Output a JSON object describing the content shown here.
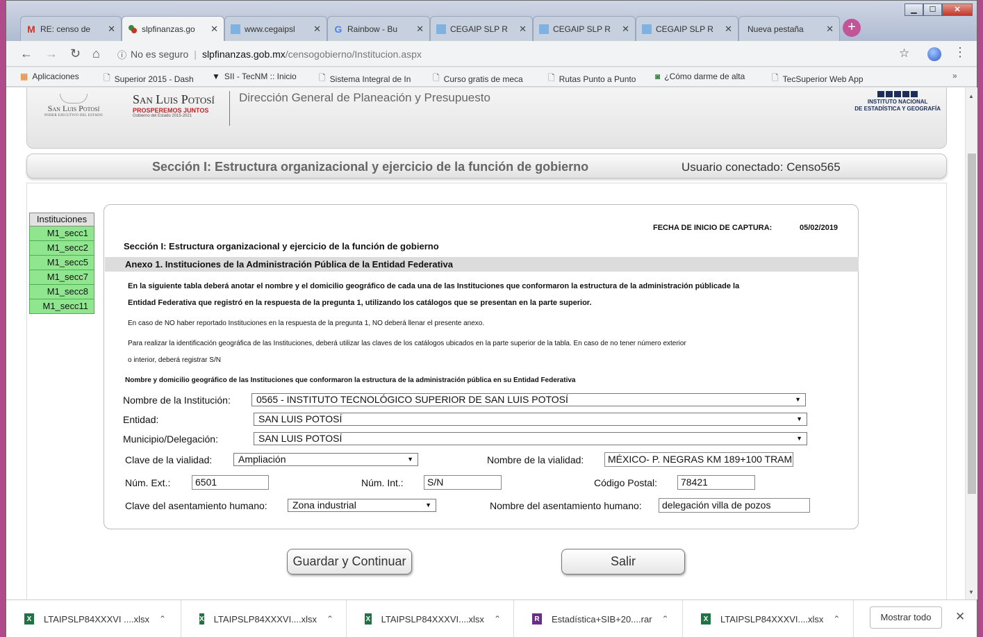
{
  "browser": {
    "tabs": [
      {
        "title": "RE: censo de",
        "favicon": "gmail-icon"
      },
      {
        "title": "slpfinanzas.go",
        "favicon": "slp-icon"
      },
      {
        "title": "www.cegaipsl",
        "favicon": "page-icon"
      },
      {
        "title": "Rainbow - Bu",
        "favicon": "google-icon"
      },
      {
        "title": "CEGAIP SLP R",
        "favicon": "page-icon"
      },
      {
        "title": "CEGAIP SLP R",
        "favicon": "page-icon"
      },
      {
        "title": "CEGAIP SLP R",
        "favicon": "page-icon"
      },
      {
        "title": "Nueva pestaña",
        "favicon": ""
      }
    ],
    "active_tab": 1,
    "address": {
      "security": "No es seguro",
      "domain": "slpfinanzas.gob.mx",
      "path": "/censogobierno/Institucion.aspx"
    },
    "bookmarks": [
      {
        "label": "Aplicaciones",
        "icon": "apps-grid-icon"
      },
      {
        "label": "Superior 2015 - Dash",
        "icon": "page-icon"
      },
      {
        "label": "SII - TecNM :: Inicio",
        "icon": "tecnm-icon"
      },
      {
        "label": "Sistema Integral de In",
        "icon": "page-icon"
      },
      {
        "label": "Curso gratis de meca",
        "icon": "page-icon"
      },
      {
        "label": "Rutas Punto a Punto",
        "icon": "page-icon"
      },
      {
        "label": "¿Cómo darme de alta",
        "icon": "sat-icon"
      },
      {
        "label": "TecSuperior Web App",
        "icon": "page-icon"
      }
    ]
  },
  "header": {
    "slp_logo_name": "San Luis Potosí",
    "slp_logo_sub": "PODER EJECUTIVO DEL ESTADO",
    "brand_name": "San Luis Potosí",
    "brand_slogan": "PROSPEREMOS JUNTOS",
    "brand_gov": "Gobierno del Estado 2015-2021",
    "department": "Dirección General de Planeación y Presupuesto",
    "inegi_line1": "INSTITUTO NACIONAL",
    "inegi_line2": "DE ESTADÍSTICA Y GEOGRAFÍA"
  },
  "section_bar": {
    "title": "Sección I: Estructura organizacional y ejercicio de la función de gobierno",
    "user": "Usuario conectado: Censo565"
  },
  "side_menu": {
    "header": "Instituciones",
    "items": [
      "M1_secc1",
      "M1_secc2",
      "M1_secc5",
      "M1_secc7",
      "M1_secc8",
      "M1_secc11"
    ]
  },
  "form": {
    "fecha_label": "FECHA DE INICIO DE CAPTURA:",
    "fecha_value": "05/02/2019",
    "section_title": "Sección I: Estructura organizacional y ejercicio de la función de gobierno",
    "annex_title": "Anexo 1. Instituciones de la Administración Pública de la Entidad Federativa",
    "instructions": [
      "En la siguiente tabla deberá anotar el nombre y el domicilio geográfico de cada una de las Instituciones que conformaron la estructura de la administración públicade la",
      "Entidad Federativa que registró en la respuesta de la pregunta 1, utilizando los catálogos que se presentan en la parte superior.",
      "En caso de NO haber reportado Instituciones en la respuesta de la pregunta 1, NO deberá llenar el presente anexo.",
      "Para realizar la identificación geográfica de las Instituciones, deberá utilizar las claves de los catálogos ubicados en la parte superior de la tabla. En caso de no tener número exterior",
      "o interior, deberá registrar S/N",
      "Nombre y domicilio geográfico de las Instituciones que conformaron la estructura de la administración pública en su Entidad Federativa"
    ],
    "fields": {
      "institucion_label": "Nombre de la Institución:",
      "institucion_value": "0565 - INSTITUTO TECNOLÓGICO SUPERIOR DE SAN LUIS POTOSÍ",
      "entidad_label": "Entidad:",
      "entidad_value": "SAN LUIS POTOSÍ",
      "municipio_label": "Municipio/Delegación:",
      "municipio_value": "SAN LUIS POTOSÍ",
      "clave_vialidad_label": "Clave de la vialidad:",
      "clave_vialidad_value": "Ampliación",
      "nombre_vialidad_label": "Nombre de la vialidad:",
      "nombre_vialidad_value": "MÉXICO- P. NEGRAS KM 189+100 TRAM",
      "num_ext_label": "Núm. Ext.:",
      "num_ext_value": "6501",
      "num_int_label": "Núm. Int.:",
      "num_int_value": "S/N",
      "cp_label": "Código Postal:",
      "cp_value": "78421",
      "clave_asent_label": "Clave del asentamiento humano:",
      "clave_asent_value": "Zona industrial",
      "nombre_asent_label": "Nombre del asentamiento humano:",
      "nombre_asent_value": "delegación villa de pozos"
    },
    "buttons": {
      "save": "Guardar y Continuar",
      "exit": "Salir"
    }
  },
  "downloads": {
    "items": [
      {
        "name": "LTAIPSLP84XXXVI ....xlsx",
        "type": "xlsx"
      },
      {
        "name": "LTAIPSLP84XXXVI....xlsx",
        "type": "xlsx"
      },
      {
        "name": "LTAIPSLP84XXXVI....xlsx",
        "type": "xlsx"
      },
      {
        "name": "Estadística+SIB+20....rar",
        "type": "rar"
      },
      {
        "name": "LTAIPSLP84XXXVI....xlsx",
        "type": "xlsx"
      }
    ],
    "show_all": "Mostrar todo"
  },
  "colors": {
    "side_item_bg": "#8fe68f",
    "annex_bar_bg": "#dcdcdc",
    "new_tab_button": "#c25597"
  }
}
